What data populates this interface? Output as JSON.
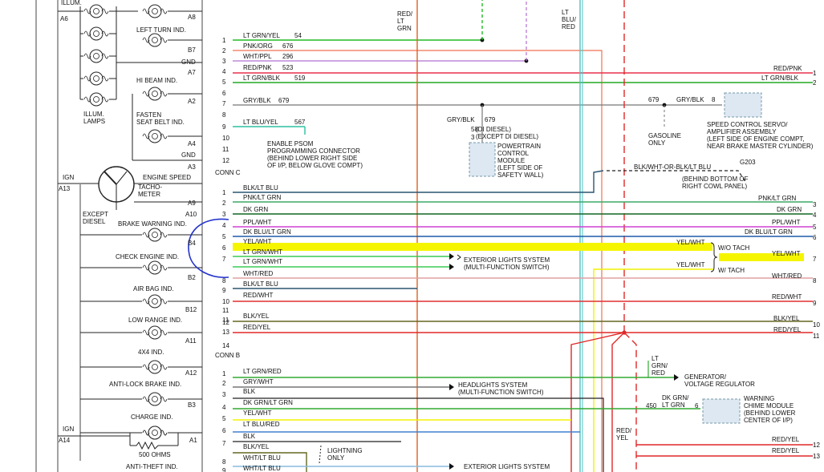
{
  "colors": {
    "lt_grn_yel": "#22bb22",
    "pnk_org": "#f07050",
    "wht_ppl": "#b070d0",
    "red_pnk": "#e8304a",
    "lt_grn_blk": "#22aa22",
    "gry": "#777777",
    "lt_blu_yel": "#2bc0a0",
    "blk_lt_blu": "#2a5570",
    "pnk_lt_grn": "#3aaa66",
    "dk_grn": "#116622",
    "ppl_wht": "#d040d0",
    "dk_blu_lt_grn": "#1e5aa8",
    "yel_wht": "#f2f200",
    "lt_grn_wht": "#3acc55",
    "wht_red": "#e0a0a0",
    "red_wht": "#e03030",
    "blk_yel": "#666622",
    "red_yel": "#e02828",
    "lt_grn_red": "#30aa30",
    "lt_blu_red": "#4080d0",
    "blk": "#222222",
    "wht_lt_blu": "#88bbdd",
    "orange": "#e06020",
    "teal": "#50c0c0",
    "highlight": "#f5f500",
    "annotation": "#2233cc",
    "module_fill": "#dde8f2"
  },
  "cluster": {
    "top_label": "ILLUM.",
    "illum_lamps": "ILLUM.\nLAMPS",
    "ign_top": "IGN",
    "ign_bottom": "IGN",
    "gnd1": "GND",
    "gnd2": "GND",
    "indicators": [
      {
        "name": "LEFT TURN IND.",
        "pin": "B7"
      },
      {
        "name": "HI BEAM IND.",
        "pin": "A2"
      },
      {
        "name": "FASTEN\nSEAT BELT IND.",
        "pin": "A4"
      },
      {
        "name": "ENGINE SPEED",
        "pin": "A9"
      },
      {
        "name": "BRAKE WARNING IND.",
        "pin": "A10"
      },
      {
        "name": "CHECK ENGINE IND.",
        "pin": "B4"
      },
      {
        "name": "AIR BAG IND.",
        "pin": "B2"
      },
      {
        "name": "LOW RANGE IND.",
        "pin": "B12"
      },
      {
        "name": "4X4 IND.",
        "pin": "A11"
      },
      {
        "name": "ANTI-LOCK BRAKE IND.",
        "pin": "A12"
      },
      {
        "name": "CHARGE IND.",
        "pin": "B3"
      },
      {
        "name": "ANTI-THEFT IND.",
        "pin": "A1"
      }
    ],
    "pins_left": [
      "A6",
      "A13",
      "A14"
    ],
    "pins_right_extra": [
      "A8",
      "A7",
      "A3"
    ],
    "tacho": "TACHO-\nMETER",
    "except_diesel": "EXCEPT\nDIESEL",
    "ohms": "500 OHMS"
  },
  "conn_c": {
    "label": "CONN C",
    "wires": [
      {
        "pin": "1",
        "color": "LT GRN/YEL",
        "circuit": "54"
      },
      {
        "pin": "2",
        "color": "PNK/ORG",
        "circuit": "676"
      },
      {
        "pin": "3",
        "color": "WHT/PPL",
        "circuit": "296"
      },
      {
        "pin": "4",
        "color": "RED/PNK",
        "circuit": "523"
      },
      {
        "pin": "5",
        "color": "LT GRN/BLK",
        "circuit": "519"
      },
      {
        "pin": "6",
        "color": "",
        "circuit": ""
      },
      {
        "pin": "7",
        "color": "GRY/BLK",
        "circuit": "679"
      },
      {
        "pin": "8",
        "color": "",
        "circuit": ""
      },
      {
        "pin": "9",
        "color": "LT BLU/YEL",
        "circuit": "567"
      },
      {
        "pin": "10",
        "color": "",
        "circuit": ""
      },
      {
        "pin": "11",
        "color": "",
        "circuit": ""
      },
      {
        "pin": "12",
        "color": "",
        "circuit": ""
      }
    ]
  },
  "conn_a": {
    "wires": [
      {
        "pin": "1",
        "color": "BLK/LT BLU"
      },
      {
        "pin": "2",
        "color": "PNK/LT GRN"
      },
      {
        "pin": "3",
        "color": "DK GRN"
      },
      {
        "pin": "4",
        "color": "PPL/WHT"
      },
      {
        "pin": "5",
        "color": "DK BLU/LT GRN"
      },
      {
        "pin": "6",
        "color": "YEL/WHT"
      },
      {
        "pin": "7",
        "color": "LT GRN/WHT"
      },
      {
        "pin": "7b",
        "color": "LT GRN/WHT"
      },
      {
        "pin": "8",
        "color": "WHT/RED"
      },
      {
        "pin": "9",
        "color": "BLK/LT BLU"
      },
      {
        "pin": "10",
        "color": "RED/WHT"
      },
      {
        "pin": "11",
        "color": "BLK/YEL"
      },
      {
        "pin": "13",
        "color": "RED/YEL"
      },
      {
        "pin": "14",
        "color": ""
      }
    ]
  },
  "conn_b": {
    "label": "CONN B",
    "wires": [
      {
        "pin": "1",
        "color": "LT GRN/RED"
      },
      {
        "pin": "2",
        "color": "GRY/WHT"
      },
      {
        "pin": "3",
        "color": "BLK"
      },
      {
        "pin": "4",
        "color": "DK GRN/LT GRN"
      },
      {
        "pin": "5",
        "color": "YEL/WHT"
      },
      {
        "pin": "6",
        "color": "LT BLU/RED"
      },
      {
        "pin": "7",
        "color": "BLK"
      },
      {
        "pin": "7b",
        "color": "BLK/YEL"
      },
      {
        "pin": "8",
        "color": "WHT/LT BLU"
      },
      {
        "pin": "9",
        "color": "WHT/LT BLU"
      }
    ]
  },
  "right_side": {
    "red_pnk": "RED/PNK",
    "lt_grn_blk": "LT GRN/BLK",
    "pnk_lt_grn": "PNK/LT GRN",
    "dk_grn": "DK GRN",
    "ppl_wht": "PPL/WHT",
    "dk_blu_lt_grn": "DK BLU/LT GRN",
    "yel_wht_wo": "YEL/WHT",
    "wo_tach": "W/O TACH",
    "yel_wht_out": "YEL/WHT",
    "yel_wht_w": "YEL/WHT",
    "w_tach": "W/ TACH",
    "wht_red": "WHT/RED",
    "red_wht": "RED/WHT",
    "blk_yel": "BLK/YEL",
    "red_yel_11": "RED/YEL",
    "red_yel_12": "RED/YEL",
    "red_yel_13": "RED/YEL",
    "pins": [
      "1",
      "2",
      "3",
      "4",
      "5",
      "6",
      "7",
      "8",
      "9",
      "10",
      "11",
      "12",
      "13"
    ]
  },
  "vertical_labels": {
    "red_lt_grn": "RED/\nLT\nGRN",
    "lt_blu_red": "LT\nBLU/\nRED",
    "red_yel": "RED/\nYEL",
    "lt_grn_red": "LT\nGRN/\nRED"
  },
  "modules": {
    "psom": "ENABLE PSOM\nPROGRAMMING CONNECTOR\n(BEHIND LOWER RIGHT SIDE\nOF I/P, BELOW GLOVE COMPT)",
    "pcm_header": "(DI DIESEL)\n(EXCEPT DI DIESEL)",
    "pcm_pins": [
      "58",
      "3"
    ],
    "pcm": "POWERTRAIN\nCONTROL\nMODULE\n(LEFT SIDE OF\nSAFETY WALL)",
    "pcm_wire": "GRY/BLK",
    "pcm_circuit": "679",
    "speed_servo": "SPEED CONTROL SERVO/\nAMPLIFIER ASSEMBLY\n(LEFT SIDE OF ENGINE COMPT,\nNEAR BRAKE MASTER CYLINDER)",
    "servo_wire": "GRY/BLK",
    "servo_circuit": "679",
    "servo_pin": "8",
    "gasoline_only": "GASOLINE\nONLY",
    "ground_wire": "BLK/WHT-OR-BLK/LT BLU",
    "ground_id": "G203",
    "ground_loc": "(BEHIND BOTTOM OF\nRIGHT COWL PANEL)",
    "ext_lights_1": "EXTERIOR LIGHTS SYSTEM\n(MULTI-FUNCTION SWITCH)",
    "headlights": "HEADLIGHTS SYSTEM\n(MULTI-FUNCTION SWITCH)",
    "generator": "GENERATOR/\nVOLTAGE REGULATOR",
    "chime": "WARNING\nCHIME MODULE\n(BEHIND LOWER\nCENTER OF I/P)",
    "chime_wire": "DK GRN/\nLT GRN",
    "chime_circuit": "450",
    "chime_pin": "6",
    "lightning_only": "LIGHTNING\nONLY",
    "ext_lights_2": "EXTERIOR LIGHTS SYSTEM"
  }
}
